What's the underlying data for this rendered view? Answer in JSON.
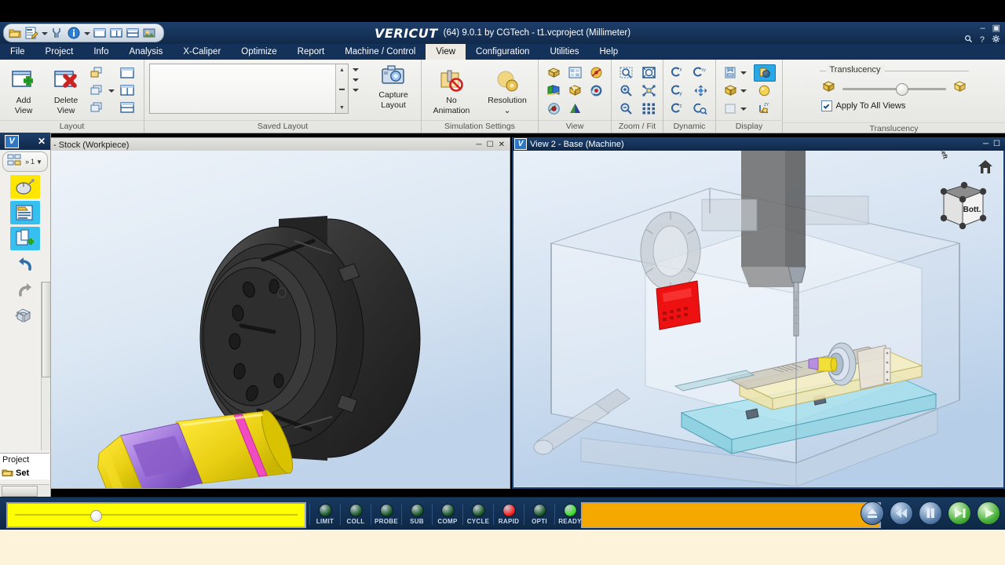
{
  "app": {
    "brand": "VERICUT",
    "title_suffix": "(64)  9.0.1 by CGTech - t1.vcproject (Millimeter)",
    "accent_blue": "#14315a",
    "highlight_cyan": "#29a8e8"
  },
  "quick_access": {
    "items": [
      {
        "name": "open-project-icon",
        "glyph": "open"
      },
      {
        "name": "edit-project-icon",
        "glyph": "edit"
      },
      {
        "name": "edit-dropdown-caret",
        "glyph": "caret"
      },
      {
        "name": "tooling-icon",
        "glyph": "tool"
      },
      {
        "name": "info-icon",
        "glyph": "info"
      },
      {
        "name": "info-dropdown-caret",
        "glyph": "caret"
      },
      {
        "name": "single-view-icon",
        "glyph": "view1"
      },
      {
        "name": "two-column-view-icon",
        "glyph": "view2"
      },
      {
        "name": "two-row-view-icon",
        "glyph": "view3"
      },
      {
        "name": "image-capture-icon",
        "glyph": "image"
      }
    ]
  },
  "window_controls": {
    "minimize": "–",
    "restore": "▣",
    "search": "search-icon",
    "help": "?",
    "settings": "gear-icon"
  },
  "menubar": {
    "items": [
      {
        "label": "File",
        "active": false
      },
      {
        "label": "Project",
        "active": false
      },
      {
        "label": "Info",
        "active": false
      },
      {
        "label": "Analysis",
        "active": false
      },
      {
        "label": "X-Caliper",
        "active": false
      },
      {
        "label": "Optimize",
        "active": false
      },
      {
        "label": "Report",
        "active": false
      },
      {
        "label": "Machine / Control",
        "active": false
      },
      {
        "label": "View",
        "active": true
      },
      {
        "label": "Configuration",
        "active": false
      },
      {
        "label": "Utilities",
        "active": false
      },
      {
        "label": "Help",
        "active": false
      }
    ]
  },
  "ribbon": {
    "groups": [
      {
        "name": "layout",
        "label": "Layout",
        "buttons": [
          {
            "name": "add-view-button",
            "line1": "Add",
            "line2": "View"
          },
          {
            "name": "delete-view-button",
            "line1": "Delete",
            "line2": "View"
          }
        ],
        "small_buttons": [
          {
            "name": "cascade-views-icon"
          },
          {
            "name": "tile-views-icon"
          },
          {
            "name": "arrange-views-icon"
          }
        ],
        "layout_presets": [
          {
            "name": "layout-single-icon"
          },
          {
            "name": "layout-vertical-split-icon"
          },
          {
            "name": "layout-horizontal-split-icon"
          }
        ]
      },
      {
        "name": "saved-layout",
        "label": "Saved Layout",
        "list_items": [],
        "capture": {
          "name": "capture-layout-button",
          "line1": "Capture",
          "line2": "Layout"
        }
      },
      {
        "name": "simulation-settings",
        "label": "Simulation Settings",
        "buttons": [
          {
            "name": "no-animation-button",
            "line1": "No",
            "line2": "Animation"
          },
          {
            "name": "resolution-button",
            "line1": "Resolution",
            "line2": "⌄"
          }
        ]
      },
      {
        "name": "view",
        "label": "View",
        "icons": [
          {
            "name": "isometric-view-icon"
          },
          {
            "name": "multi-pane-view-icon"
          },
          {
            "name": "view-axis-icon"
          },
          {
            "name": "section-view-icon"
          },
          {
            "name": "shaded-view-icon"
          },
          {
            "name": "rotate-view-icon"
          },
          {
            "name": "view-orientation-icon"
          },
          {
            "name": "view-cone-icon"
          }
        ]
      },
      {
        "name": "zoom-fit",
        "label": "Zoom / Fit",
        "icons": [
          {
            "name": "zoom-window-icon"
          },
          {
            "name": "fit-all-icon"
          },
          {
            "name": "zoom-in-icon"
          },
          {
            "name": "fit-selection-icon"
          },
          {
            "name": "zoom-out-icon"
          },
          {
            "name": "fit-extents-icon"
          }
        ]
      },
      {
        "name": "dynamic",
        "label": "Dynamic",
        "icons": [
          {
            "name": "rotate-x-icon"
          },
          {
            "name": "rotate-xy-icon"
          },
          {
            "name": "rotate-y-icon"
          },
          {
            "name": "pan-icon"
          },
          {
            "name": "rotate-z-icon"
          },
          {
            "name": "dynamic-zoom-icon"
          }
        ]
      },
      {
        "name": "display",
        "label": "Display",
        "icons": [
          {
            "name": "display-mode-icon",
            "has_caret": true
          },
          {
            "name": "translucent-shade-icon",
            "selected": true
          },
          {
            "name": "solid-shade-icon",
            "has_caret": true
          },
          {
            "name": "sphere-shade-icon"
          },
          {
            "name": "wireframe-icon",
            "has_caret": true
          },
          {
            "name": "axis-display-icon"
          }
        ]
      },
      {
        "name": "translucency",
        "label": "Translucency",
        "fieldset_caption": "Translucency",
        "slider_value": 52,
        "left_icon": "opaque-cube-icon",
        "right_icon": "translucent-cube-icon",
        "checkbox": {
          "name": "apply-to-all-views-checkbox",
          "label": "Apply To All Views",
          "checked": true
        }
      }
    ]
  },
  "left_dock": {
    "logo": "V",
    "close": "✕",
    "toolbar_caret": "▼",
    "toolbar_count": "1",
    "toolbar_chevrons": "»",
    "buttons": [
      {
        "name": "mouse-config-icon",
        "highlight": "yellow"
      },
      {
        "name": "setup-list-icon",
        "highlight": "cyan"
      },
      {
        "name": "add-setup-icon",
        "highlight": "cyan"
      },
      {
        "name": "undo-icon",
        "highlight": "none"
      },
      {
        "name": "redo-icon",
        "highlight": "none"
      },
      {
        "name": "stock-view-icon",
        "highlight": "none"
      }
    ],
    "tree": {
      "header": "Project",
      "rows": [
        {
          "name": "tree-item-setup",
          "label": "Set",
          "icon": "setup-icon"
        },
        {
          "name": "tree-item-play",
          "label": "",
          "icon": "play-icon"
        }
      ]
    }
  },
  "viewports": [
    {
      "name": "stock-viewport",
      "title": "- Stock (Workpiece)",
      "active": false,
      "controls": [
        "minimize",
        "maximize",
        "close"
      ],
      "scene": "lathe chuck with yellow and purple turned workpiece"
    },
    {
      "name": "machine-viewport",
      "title": "View 2 - Base (Machine)",
      "active": true,
      "controls": [
        "minimize",
        "maximize"
      ],
      "scene": "translucent 5-axis machining centre with red HAAS control panel, cyan table and chuck",
      "nav_cube": {
        "front_face": "Bott.",
        "side_face": "Left"
      },
      "home_icon": "home-icon"
    }
  ],
  "statusbar": {
    "progress_left": {
      "name": "simulation-progress-slider",
      "value": 28,
      "color": "#ffff00"
    },
    "progress_right": {
      "name": "nc-program-progress-bar",
      "value": 100,
      "color": "#f5a800"
    },
    "leds": [
      {
        "label": "LIMIT",
        "state": "off",
        "color": "#1c5c2c"
      },
      {
        "label": "COLL",
        "state": "off",
        "color": "#1c5c2c"
      },
      {
        "label": "PROBE",
        "state": "off",
        "color": "#1c5c2c"
      },
      {
        "label": "SUB",
        "state": "off",
        "color": "#1c5c2c"
      },
      {
        "label": "COMP",
        "state": "off",
        "color": "#1c5c2c"
      },
      {
        "label": "CYCLE",
        "state": "off",
        "color": "#1c5c2c"
      },
      {
        "label": "RAPID",
        "state": "on",
        "color": "#ff2020"
      },
      {
        "label": "OPTI",
        "state": "off",
        "color": "#1c5c2c"
      },
      {
        "label": "READY",
        "state": "on",
        "color": "#3fe02a"
      }
    ],
    "transport": [
      {
        "name": "reset-button",
        "glyph": "eject"
      },
      {
        "name": "rewind-button",
        "glyph": "rewind"
      },
      {
        "name": "pause-button",
        "glyph": "pause"
      },
      {
        "name": "single-step-button",
        "glyph": "step",
        "color": "green"
      },
      {
        "name": "play-button",
        "glyph": "play",
        "color": "green"
      }
    ]
  }
}
